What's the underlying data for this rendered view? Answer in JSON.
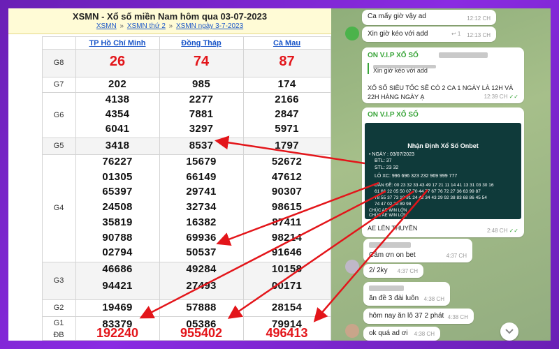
{
  "header": {
    "title": "XSMN - Xổ số miền Nam hôm qua 03-07-2023",
    "breadcrumb": [
      "XSMN",
      "XSMN thứ 2",
      "XSMN ngày 3-7-2023"
    ],
    "separator": "»"
  },
  "provinces": [
    "TP Hồ Chí Minh",
    "Đồng Tháp",
    "Cà Mau"
  ],
  "prizes": {
    "g8": {
      "label": "G8",
      "values": [
        "26",
        "74",
        "87"
      ]
    },
    "g7": {
      "label": "G7",
      "values": [
        "202",
        "985",
        "174"
      ]
    },
    "g6": {
      "label": "G6",
      "values": [
        [
          "4138",
          "4354",
          "6041"
        ],
        [
          "2277",
          "7881",
          "3297"
        ],
        [
          "2166",
          "2847",
          "5971"
        ]
      ]
    },
    "g5": {
      "label": "G5",
      "values": [
        "3418",
        "8537",
        "1797"
      ]
    },
    "g4": {
      "label": "G4",
      "values": [
        [
          "76227",
          "01305",
          "65397",
          "24508",
          "35819",
          "90788",
          "02794"
        ],
        [
          "15679",
          "66149",
          "29741",
          "32734",
          "16382",
          "69936",
          "50537"
        ],
        [
          "52672",
          "47612",
          "90307",
          "98615",
          "87411",
          "98214",
          "91646"
        ]
      ]
    },
    "g3": {
      "label": "G3",
      "values": [
        [
          "46686",
          "94421"
        ],
        [
          "49284",
          "27493"
        ],
        [
          "10158",
          "00171"
        ]
      ]
    },
    "g2": {
      "label": "G2",
      "values": [
        "19469",
        "57888",
        "28154"
      ]
    },
    "g1": {
      "label": "G1",
      "values": [
        "83379",
        "05386",
        "79914"
      ]
    },
    "db": {
      "label": "ĐB",
      "values": [
        "192240",
        "955402",
        "496413"
      ]
    }
  },
  "chat": {
    "msg1": {
      "text": "Ca mấy giờ vậy ad",
      "time": "12:12 CH"
    },
    "msg2": {
      "text": "Xin giờ kéo với add",
      "time": "12:13 CH",
      "reply_icon": "↩ 1"
    },
    "msg3": {
      "sender": "ON V.I.P XỔ SỐ",
      "quote_text": "Xin giờ kéo với add",
      "text": "XỔ SỐ SIÊU TỐC SẼ CÓ 2 CA 1 NGÀY LÀ 12H VÀ 22H HÀNG NGÀY Ạ",
      "time": "12:39 CH"
    },
    "msg4": {
      "sender": "ON V.I.P XỔ SỐ",
      "card": {
        "title": "Nhận Định Xổ Số Onbet",
        "date_line": "• NGÀY : 03/07/2023",
        "btl_line": "BTL: 37",
        "stl_line": "STL: 23 32",
        "loxien_line": "LÔ XC:  996 696 323 232 969 999 777",
        "dan_de_line1": "DÀN ĐỀ: 00 23 32 33 43 49 17 21 11 14 41 13 31 03 30 16",
        "dan_de_line2": "61 66 22 05 50 07 70 44 77 67 76 72 27 36 63 99 87",
        "dan_de_line3": "78 55 37 73 19 91 24 42 34 43 29 92 38 83 68 86 45 54",
        "dan_de_line4": "74 47 02 20 89 98",
        "footer1": "CHÚC AE WIN LỚN",
        "footer2": "CHÚC AE WIN LỚN"
      },
      "text": "AE LÊN THUYỀN",
      "time": "2:48 CH"
    },
    "msg5": {
      "text": "Cảm ơn on bet",
      "time": "4:37 CH"
    },
    "msg6": {
      "text": "2/ 2ky",
      "time": "4:37 CH"
    },
    "msg7": {
      "text": "ăn đề 3 đài luôn",
      "time": "4:38 CH"
    },
    "msg8": {
      "text": "hôm nay ăn lô 37 2 phát",
      "time": "4:38 CH"
    },
    "msg9": {
      "text": "ok quá ad ơi",
      "time": "4:38 CH"
    },
    "check_icon": "✓✓",
    "scroll_icon": "chevron-down-icon"
  },
  "colors": {
    "accent_red": "#e3151a",
    "arrow_red": "#e3151a",
    "link_blue": "#1a56c8",
    "sender_green": "#3aa53a"
  }
}
